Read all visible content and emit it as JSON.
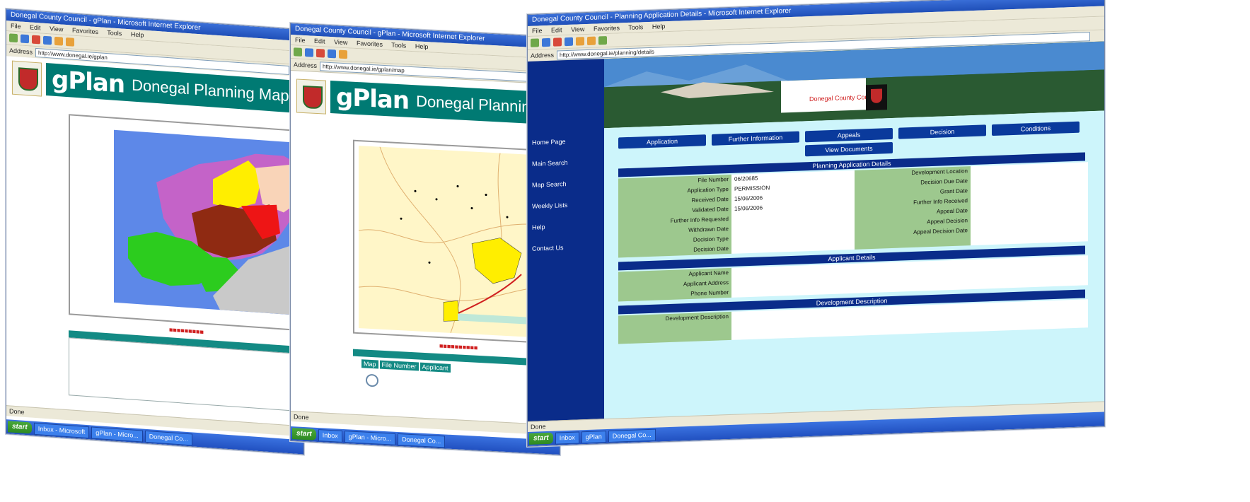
{
  "windows": [
    {
      "title": "Donegal County Council - gPlan - Microsoft Internet Explorer",
      "menus": [
        "File",
        "Edit",
        "View",
        "Favorites",
        "Tools",
        "Help"
      ],
      "address_label": "Address",
      "address": "http://www.donegal.ie/gplan",
      "logo": "gPlan",
      "header_title": "Donegal Planning Map",
      "status": "Done",
      "taskbar": [
        "start",
        "Inbox - Microsoft",
        "gPlan - Micro...",
        "Donegal Co..."
      ]
    },
    {
      "title": "Donegal County Council - gPlan - Microsoft Internet Explorer",
      "menus": [
        "File",
        "Edit",
        "View",
        "Favorites",
        "Tools",
        "Help"
      ],
      "address_label": "Address",
      "address": "http://www.donegal.ie/gplan/map",
      "logo": "gPlan",
      "header_title": "Donegal Planning",
      "table_headers": [
        "Map",
        "File Number",
        "Applicant"
      ],
      "status": "Done",
      "taskbar": [
        "start",
        "Inbox",
        "gPlan - Micro...",
        "Donegal Co..."
      ]
    },
    {
      "title": "Donegal County Council - Planning Application Details - Microsoft Internet Explorer",
      "menus": [
        "File",
        "Edit",
        "View",
        "Favorites",
        "Tools",
        "Help"
      ],
      "address_label": "Address",
      "address": "http://www.donegal.ie/planning/details",
      "nav_items": [
        "Home Page",
        "Main Search",
        "Map Search",
        "Weekly Lists",
        "Help",
        "Contact Us"
      ],
      "banner_text": "Donegal County Council",
      "buttons_row1": [
        "Application",
        "Further Information",
        "Appeals",
        "Decision",
        "Conditions"
      ],
      "buttons_row2": [
        "View Documents"
      ],
      "section_details": "Planning Application Details",
      "labels_left": [
        "File Number",
        "Application Type",
        "Received Date",
        "Validated Date",
        "Further Info Requested",
        "Withdrawn Date",
        "Decision Type",
        "Decision Date"
      ],
      "values_left": [
        "06/20685",
        "PERMISSION",
        "15/06/2006",
        "15/06/2006",
        "",
        "",
        "",
        ""
      ],
      "labels_right": [
        "Development Location",
        "Decision Due Date",
        "Grant Date",
        "Further Info Received",
        "Appeal Date",
        "Appeal Decision",
        "Appeal Decision Date"
      ],
      "section_applicant": "Applicant Details",
      "applicant_labels": [
        "Applicant Name",
        "Applicant Address",
        "Phone Number"
      ],
      "section_development": "Development Description",
      "development_label": "Development Description",
      "status": "Done",
      "taskbar": [
        "start",
        "Inbox",
        "gPlan",
        "Donegal Co..."
      ]
    }
  ]
}
